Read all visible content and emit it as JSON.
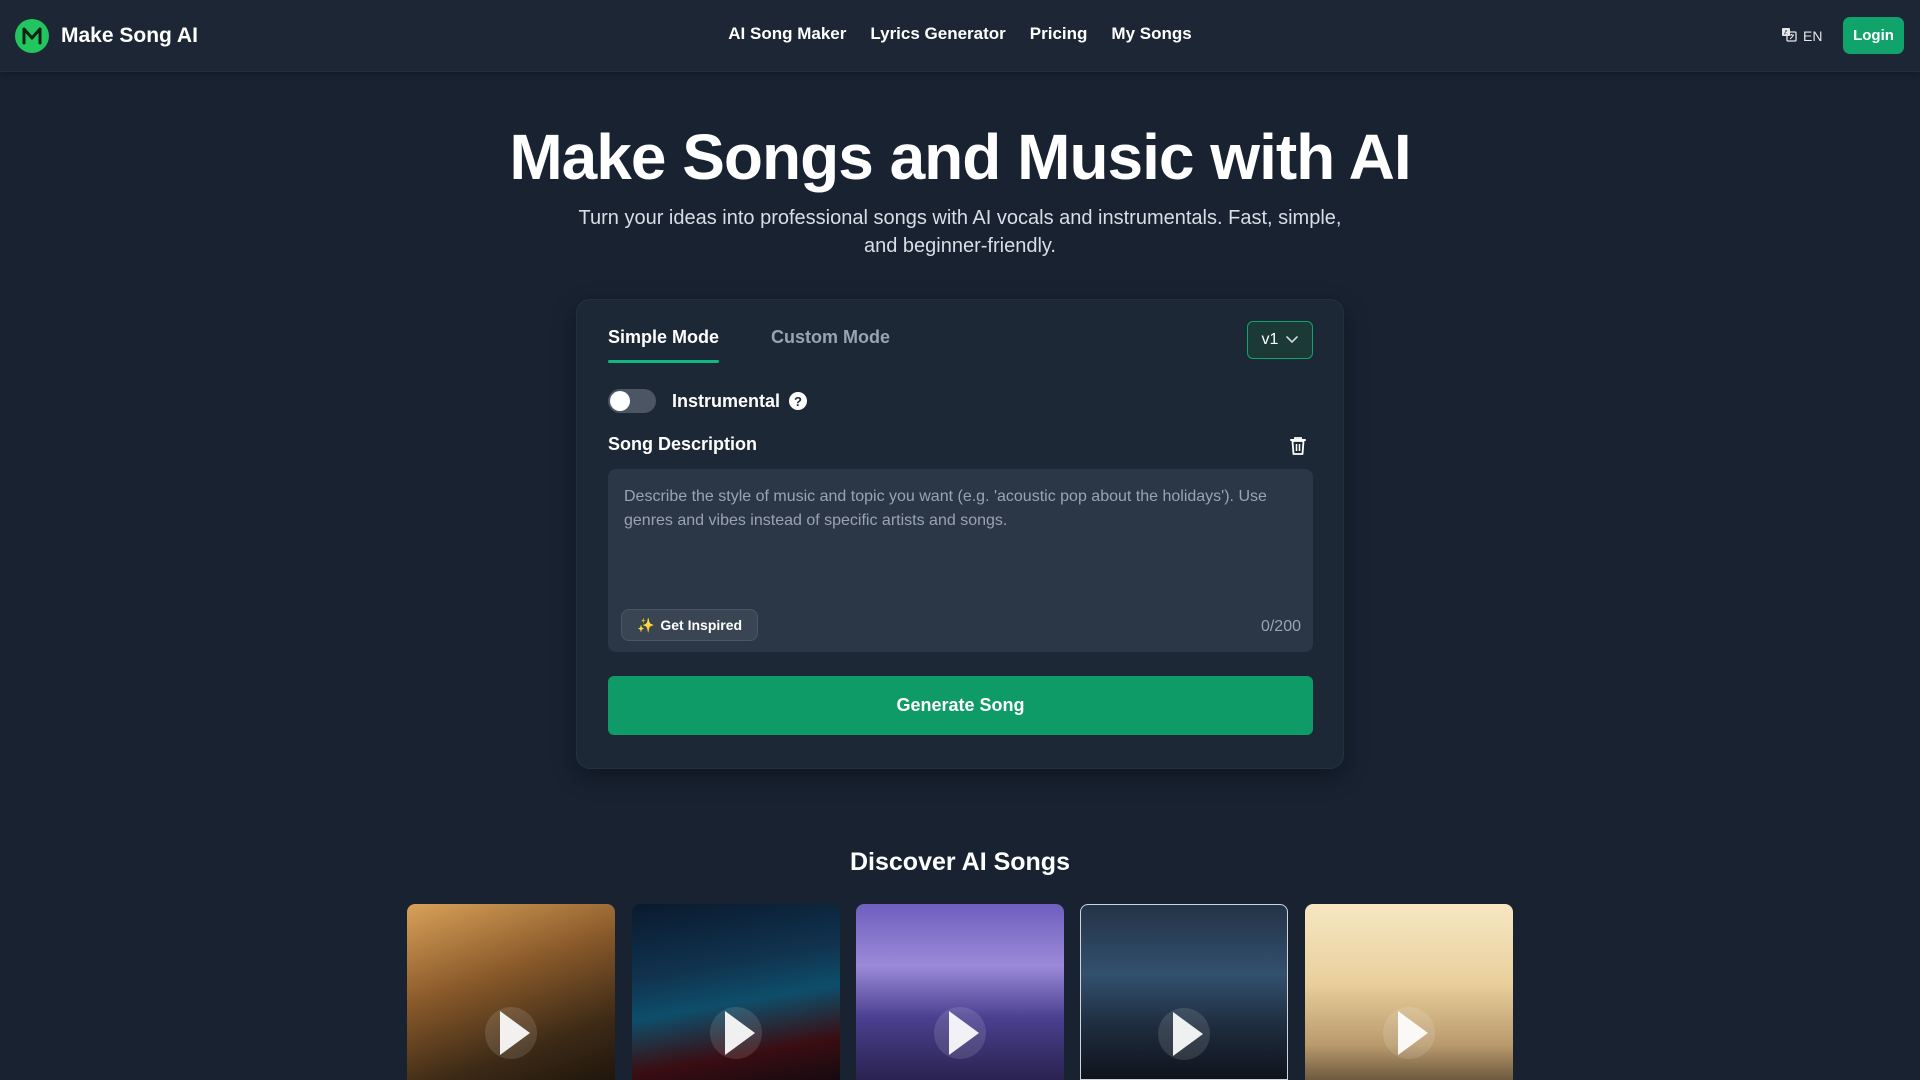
{
  "header": {
    "brand": "Make Song AI",
    "logo_letter": "M",
    "nav": [
      "AI Song Maker",
      "Lyrics Generator",
      "Pricing",
      "My Songs"
    ],
    "language": "EN",
    "login_label": "Login"
  },
  "hero": {
    "title": "Make Songs and Music with AI",
    "subtitle": "Turn your ideas into professional songs with AI vocals and instrumentals. Fast, simple, and beginner-friendly."
  },
  "generator": {
    "tabs": [
      {
        "label": "Simple Mode",
        "active": true
      },
      {
        "label": "Custom Mode",
        "active": false
      }
    ],
    "version": "v1",
    "instrumental_label": "Instrumental",
    "instrumental_on": false,
    "help_glyph": "?",
    "description_label": "Song Description",
    "description_placeholder": "Describe the style of music and topic you want (e.g. 'acoustic pop about the holidays'). Use genres and vibes instead of specific artists and songs.",
    "description_value": "",
    "get_inspired_label": "Get Inspired",
    "get_inspired_icon": "✨",
    "counter": "0/200",
    "generate_label": "Generate Song"
  },
  "discover": {
    "title": "Discover AI Songs",
    "song_count": 5
  },
  "colors": {
    "background": "#182231",
    "accent": "#10a36b",
    "brand_logo": "#22c55e"
  },
  "icons": [
    "logo-icon",
    "language-icon",
    "chevron-down-icon",
    "help-icon",
    "trash-icon",
    "sparkles-icon",
    "play-icon"
  ]
}
